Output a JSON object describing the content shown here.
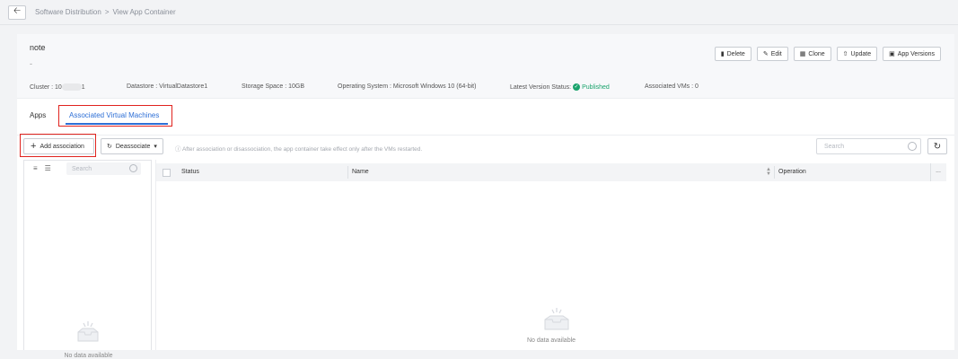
{
  "breadcrumb": {
    "root": "Software Distribution",
    "sep": ">",
    "current": "View App Container"
  },
  "info": {
    "title": "note",
    "description": "-",
    "actions": [
      "Delete",
      "Edit",
      "Clone",
      "Update",
      "App Versions"
    ],
    "cluster_label": "Cluster : 10",
    "cluster_tail": "1",
    "datastore": "Datastore : VirtualDatastore1",
    "storage": "Storage Space : 10GB",
    "os": "Operating System : Microsoft Windows 10 (64-bit)",
    "status_label": "Latest Version Status:",
    "status_value": "Published",
    "vms": "Associated VMs : 0"
  },
  "tabs": [
    "Apps",
    "Associated Virtual Machines"
  ],
  "toolbar": {
    "add_label": "Add association",
    "deassoc_label": "Deassociate",
    "hint": "After association or disassociation, the app container take effect only after the VMs restarted.",
    "search_placeholder": "Search"
  },
  "left_panel": {
    "search_placeholder": "Search",
    "empty_text": "No data available"
  },
  "table": {
    "columns": [
      "Status",
      "Name",
      "Operation"
    ],
    "more": "...",
    "empty_text": "No data available"
  },
  "colors": {
    "accent": "#2d6fd6",
    "published": "#1aa36c",
    "highlight": "#e0231e"
  }
}
